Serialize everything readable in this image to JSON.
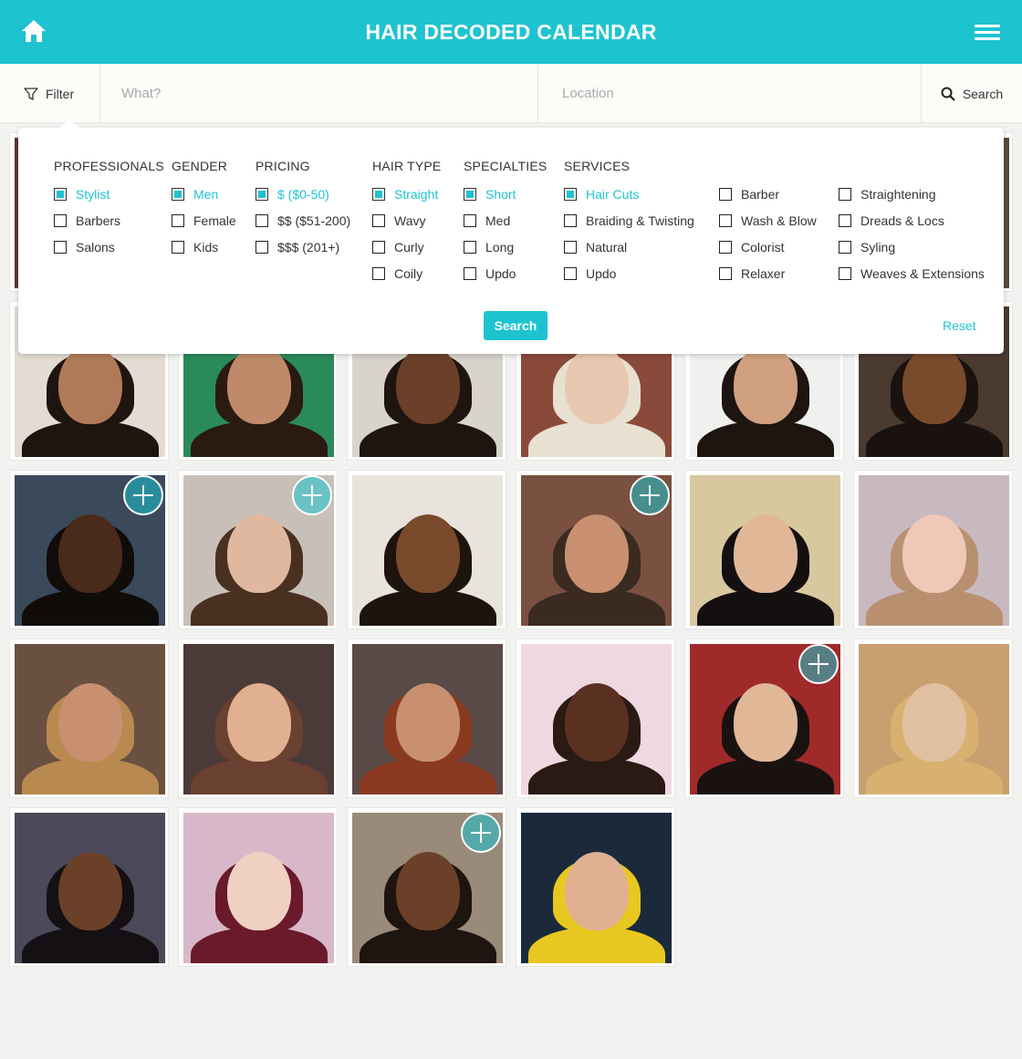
{
  "header": {
    "title": "HAIR DECODED CALENDAR"
  },
  "searchbar": {
    "filter_label": "Filter",
    "what_placeholder": "What?",
    "location_placeholder": "Location",
    "search_label": "Search"
  },
  "filters": {
    "professionals": {
      "title": "PROFESSIONALS",
      "options": [
        "Stylist",
        "Barbers",
        "Salons"
      ],
      "checked": [
        "Stylist"
      ]
    },
    "gender": {
      "title": "GENDER",
      "options": [
        "Men",
        "Female",
        "Kids"
      ],
      "checked": [
        "Men"
      ]
    },
    "pricing": {
      "title": "PRICING",
      "options": [
        "$ ($0-50)",
        "$$ ($51-200)",
        "$$$ (201+)"
      ],
      "checked": [
        "$ ($0-50)"
      ]
    },
    "hair_type": {
      "title": "HAIR TYPE",
      "options": [
        "Straight",
        "Wavy",
        "Curly",
        "Coily"
      ],
      "checked": [
        "Straight"
      ]
    },
    "specialties": {
      "title": "SPECIALTIES",
      "options": [
        "Short",
        "Med",
        "Long",
        "Updo"
      ],
      "checked": [
        "Short"
      ]
    },
    "services": {
      "title": "SERVICES",
      "col1": [
        "Hair Cuts",
        "Braiding & Twisting",
        "Natural",
        "Updo"
      ],
      "col2": [
        "Barber",
        "Wash & Blow",
        "Colorist",
        "Relaxer"
      ],
      "col3": [
        "Straightening",
        "Dreads & Locs",
        "Syling",
        "Weaves & Extensions"
      ],
      "checked": [
        "Hair Cuts"
      ]
    },
    "search_label": "Search",
    "reset_label": "Reset"
  },
  "colors": {
    "accent": "#1ec3d0",
    "background": "#f2f2f0"
  },
  "gallery": [
    {
      "bg": "#5a3a32",
      "skin": "#8a5a3c",
      "hair": "#2a1a12",
      "add": false
    },
    {
      "bg": "#8b2a2a",
      "skin": "#c48a6a",
      "hair": "#2a1a12",
      "add": false
    },
    {
      "bg": "#b07a5a",
      "skin": "#7a4a30",
      "hair": "#1a120e",
      "add": false
    },
    {
      "bg": "#7a3a2a",
      "skin": "#e8c0a0",
      "hair": "#d8c8a0",
      "add": false
    },
    {
      "bg": "#d8d8d8",
      "skin": "#c89a78",
      "hair": "#2a1e16",
      "add": false
    },
    {
      "bg": "#5a4a3a",
      "skin": "#6a4028",
      "hair": "#1a120e",
      "add": false
    },
    {
      "bg": "#e4dcd2",
      "skin": "#b07a58",
      "hair": "#1e1410",
      "add": false
    },
    {
      "bg": "#2a8a5a",
      "skin": "#c08a6a",
      "hair": "#2a1a12",
      "add": false
    },
    {
      "bg": "#d8d4cc",
      "skin": "#6a4028",
      "hair": "#1e1410",
      "add": false
    },
    {
      "bg": "#8a4a3a",
      "skin": "#e8c8b0",
      "hair": "#e8e0d0",
      "add": false
    },
    {
      "bg": "#f0f0ee",
      "skin": "#d0a080",
      "hair": "#1e1410",
      "add": false
    },
    {
      "bg": "#4a3a30",
      "skin": "#7a4a2c",
      "hair": "#1a120e",
      "add": false
    },
    {
      "bg": "#3a4a5a",
      "skin": "#4a2a1a",
      "hair": "#100c0a",
      "add": true
    },
    {
      "bg": "#c8c0b8",
      "skin": "#e0b8a0",
      "hair": "#4a3020",
      "add": true
    },
    {
      "bg": "#e8e4dc",
      "skin": "#7a4a2c",
      "hair": "#1e140e",
      "add": false
    },
    {
      "bg": "#7a5040",
      "skin": "#c89070",
      "hair": "#3a2a20",
      "add": true
    },
    {
      "bg": "#d8c8a0",
      "skin": "#e0b898",
      "hair": "#141010",
      "add": false
    },
    {
      "bg": "#c8b8c0",
      "skin": "#f0c8b8",
      "hair": "#b89070",
      "add": false
    },
    {
      "bg": "#6a5040",
      "skin": "#c89070",
      "hair": "#b88a50",
      "add": false
    },
    {
      "bg": "#4a3a38",
      "skin": "#e0b090",
      "hair": "#6a4030",
      "add": false
    },
    {
      "bg": "#5a4a48",
      "skin": "#c89070",
      "hair": "#8a3a20",
      "add": false
    },
    {
      "bg": "#f0d8e0",
      "skin": "#5a3020",
      "hair": "#2a1a14",
      "add": false
    },
    {
      "bg": "#a02a2a",
      "skin": "#e0b898",
      "hair": "#1a120e",
      "add": true
    },
    {
      "bg": "#c8a070",
      "skin": "#e0c0a0",
      "hair": "#d8b070",
      "add": false
    },
    {
      "bg": "#4a4a5a",
      "skin": "#6a4028",
      "hair": "#141014",
      "add": false
    },
    {
      "bg": "#d8b8c8",
      "skin": "#f0d0c0",
      "hair": "#6a1a2a",
      "add": false
    },
    {
      "bg": "#9a8a7a",
      "skin": "#6a4028",
      "hair": "#1e1410",
      "add": true
    },
    {
      "bg": "#1a2a3a",
      "skin": "#e0b090",
      "hair": "#e8c820",
      "add": false
    }
  ]
}
